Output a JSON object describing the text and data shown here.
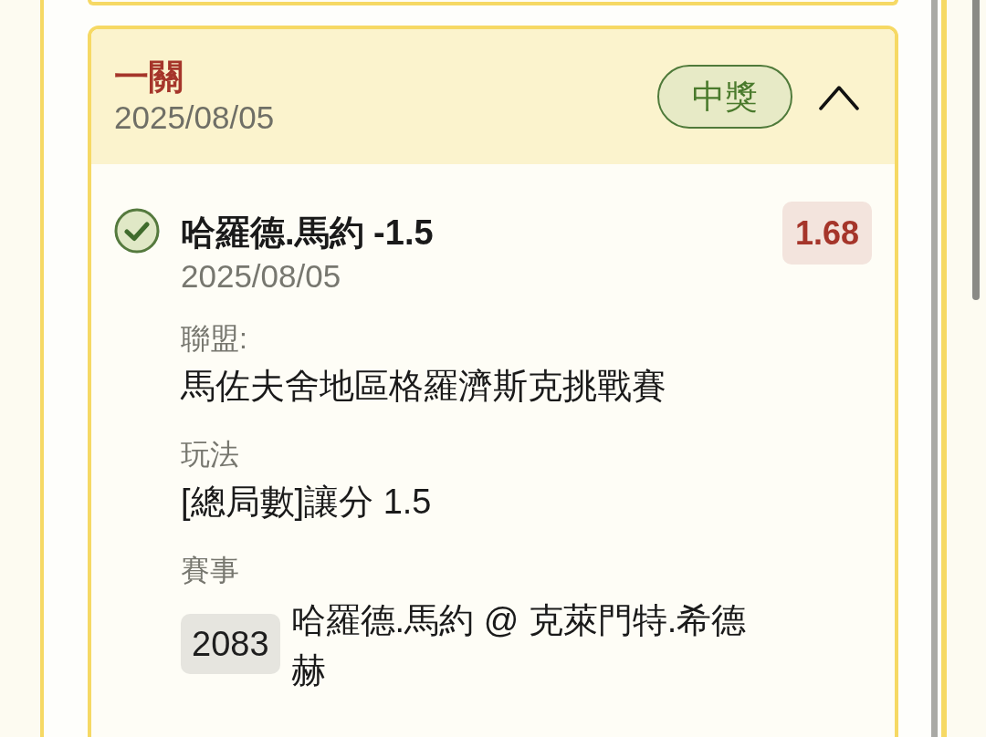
{
  "ticket": {
    "title": "一關",
    "date": "2025/08/05",
    "status": {
      "label": "中獎",
      "won": true
    },
    "expanded": true,
    "selections": [
      {
        "won": true,
        "name": "哈羅德.馬約 -1.5",
        "date": "2025/08/05",
        "odds": "1.68",
        "fields": [
          {
            "kind": "text",
            "label": "聯盟:",
            "value": "馬佐夫舍地區格羅濟斯克挑戰賽"
          },
          {
            "kind": "text",
            "label": "玩法",
            "value": "[總局數]讓分 1.5"
          },
          {
            "kind": "event",
            "label": "賽事",
            "number": "2083",
            "value": "哈羅德.馬約 @ 克萊門特.希德赫"
          }
        ]
      }
    ]
  }
}
